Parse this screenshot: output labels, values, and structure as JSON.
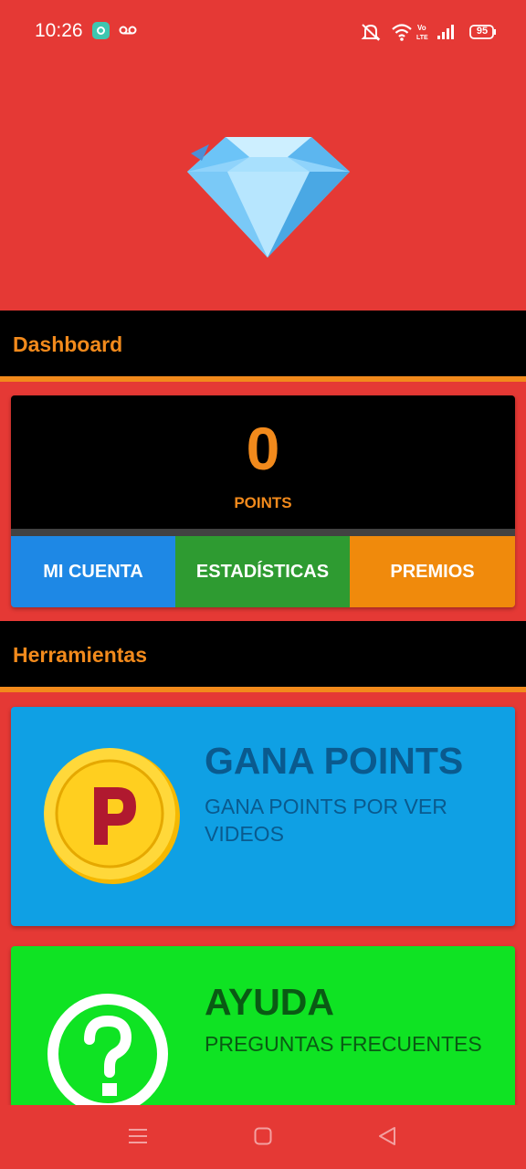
{
  "status_bar": {
    "time": "10:26",
    "battery": "95",
    "icons": [
      "chat-app-icon",
      "voicemail-icon",
      "mute-icon",
      "wifi-icon",
      "volte-icon",
      "signal-icon",
      "battery-icon"
    ]
  },
  "hero": {
    "icon": "diamond-icon"
  },
  "dashboard": {
    "title": "Dashboard",
    "points_value": "0",
    "points_label": "POINTS",
    "buttons": {
      "mi_cuenta": "MI CUENTA",
      "estadisticas": "ESTADÍSTICAS",
      "premios": "PREMIOS"
    }
  },
  "tools": {
    "title": "Herramientas",
    "items": [
      {
        "title": "GANA POINTS",
        "subtitle": "GANA POINTS POR VER VIDEOS",
        "icon": "coin-p-icon"
      },
      {
        "title": "AYUDA",
        "subtitle": "PREGUNTAS FRECUENTES",
        "icon": "question-icon"
      }
    ]
  },
  "colors": {
    "background": "#e53935",
    "accent": "#f28a1c",
    "mi_cuenta": "#1e88e5",
    "estadisticas": "#2e9b31",
    "premios": "#f08a0c",
    "gana_points_card": "#0fa0e4",
    "ayuda_card": "#0fe323"
  }
}
